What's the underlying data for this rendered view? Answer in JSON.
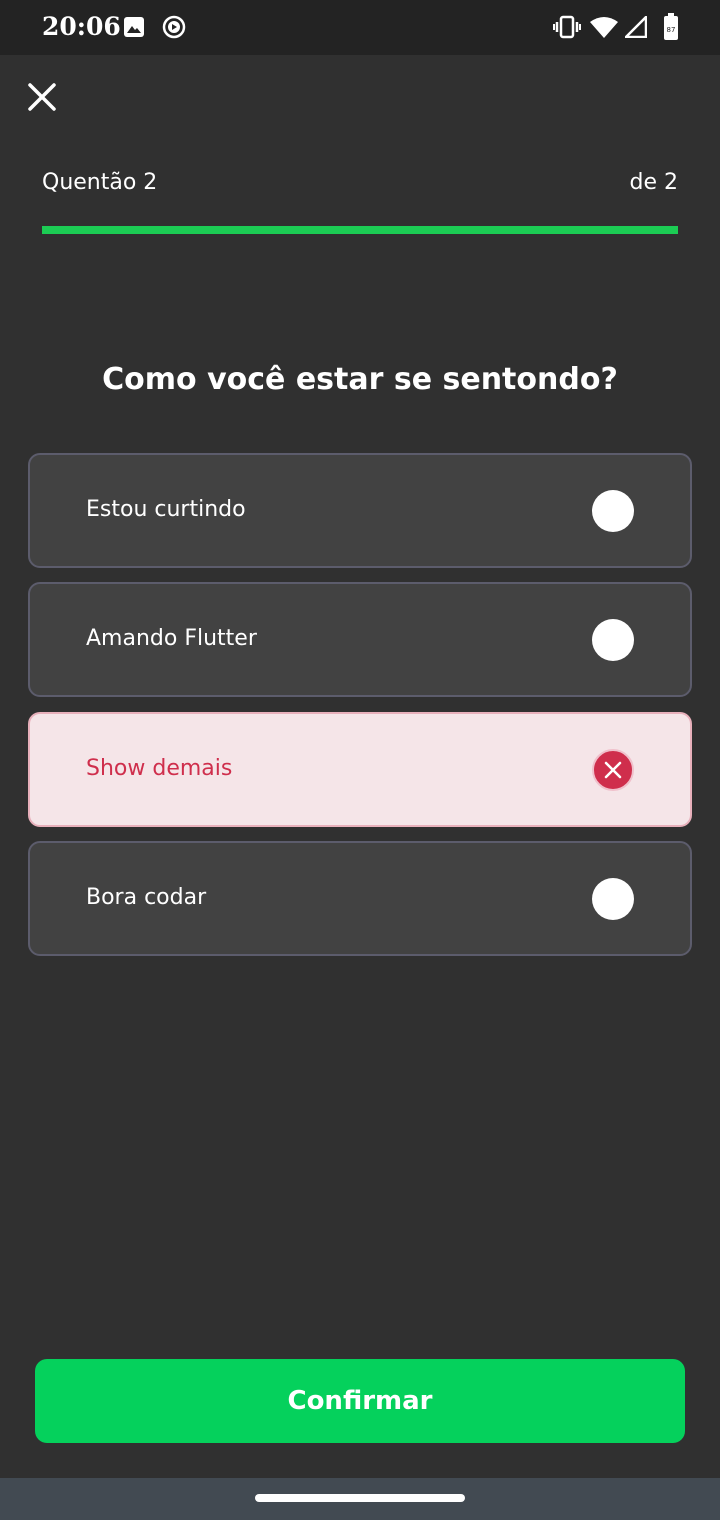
{
  "status_bar": {
    "time": "20:06",
    "battery_level": "87",
    "icons": [
      "image-icon",
      "play-circle-icon",
      "vibrate-icon",
      "wifi-icon",
      "signal-icon",
      "battery-icon"
    ]
  },
  "quiz": {
    "question_label": "Quentão 2",
    "question_total": "de 2",
    "progress": 1.0,
    "question": "Como você estar se sentondo?",
    "options": [
      {
        "label": "Estou curtindo",
        "state": "unselected"
      },
      {
        "label": "Amando Flutter",
        "state": "unselected"
      },
      {
        "label": "Show demais",
        "state": "wrong"
      },
      {
        "label": "Bora codar",
        "state": "unselected"
      }
    ],
    "confirm_label": "Confirmar"
  },
  "colors": {
    "background": "#303030",
    "accent_green": "#05d15c",
    "wrong_red": "#cf2e4c",
    "wrong_bg": "#f5e5e8"
  }
}
